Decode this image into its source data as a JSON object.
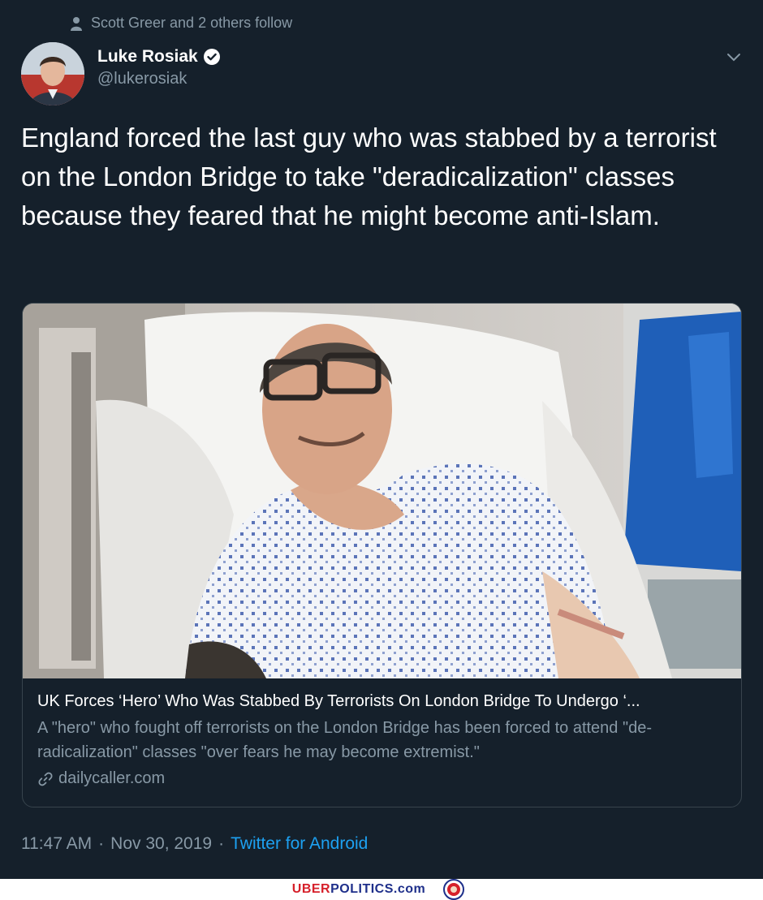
{
  "social_context": {
    "text": "Scott Greer and 2 others follow",
    "icon": "person-icon"
  },
  "author": {
    "display_name": "Luke Rosiak",
    "handle": "@lukerosiak",
    "verified": true
  },
  "tweet": {
    "text": "England forced the last guy who was stabbed by a terrorist on the London Bridge to take \"deradicalization\" classes because they feared that he might become anti-Islam."
  },
  "card": {
    "title": "UK Forces ‘Hero’ Who Was Stabbed By Terrorists On London Bridge To Undergo ‘...",
    "description": "A \"hero\" who fought off terrorists on the London Bridge has been forced to attend \"de-radicalization\" classes \"over fears he may become extremist.\"",
    "domain": "dailycaller.com"
  },
  "meta": {
    "time": "11:47 AM",
    "sep1": "·",
    "date": "Nov 30, 2019",
    "sep2": "·",
    "source": "Twitter for Android"
  },
  "footer": {
    "brand_part1": "UBER",
    "brand_part2": "POLITICS",
    "brand_part3": ".com"
  },
  "colors": {
    "background": "#15202b",
    "secondary_text": "#8899a6",
    "link": "#1da1f2",
    "border": "#38444d"
  }
}
